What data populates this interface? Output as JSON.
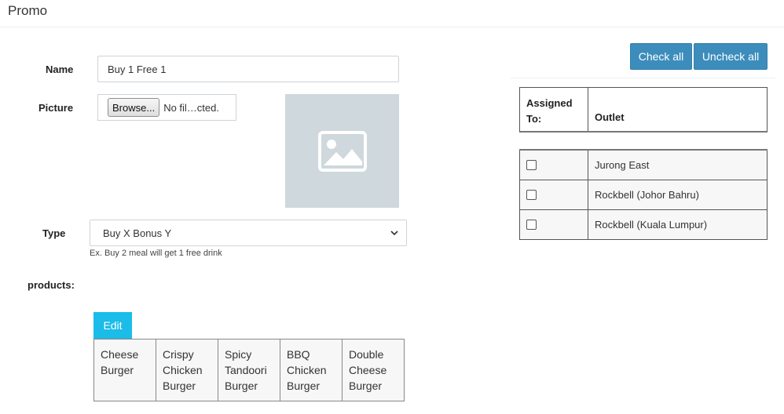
{
  "page": {
    "title": "Promo"
  },
  "form": {
    "name_label": "Name",
    "name_value": "Buy 1 Free 1",
    "picture_label": "Picture",
    "browse_label": "Browse...",
    "file_status": "No fil…cted.",
    "type_label": "Type",
    "type_value": "Buy X Bonus Y",
    "type_help": "Ex. Buy 2 meal will get 1 free drink",
    "products_label": "products:",
    "edit_label": "Edit",
    "products": [
      "Cheese Burger",
      "Crispy Chicken Burger",
      "Spicy Tandoori Burger",
      "BBQ Chicken Burger",
      "Double Cheese Burger"
    ]
  },
  "outlets": {
    "check_all_label": "Check all",
    "uncheck_all_label": "Uncheck all",
    "col_assigned": "Assigned To:",
    "col_outlet": "Outlet",
    "rows": [
      {
        "name": "Jurong East",
        "checked": false
      },
      {
        "name": "Rockbell (Johor Bahru)",
        "checked": false
      },
      {
        "name": "Rockbell (Kuala Lumpur)",
        "checked": false
      }
    ]
  },
  "colors": {
    "primary": "#3c8dbc",
    "info": "#1bbce8",
    "placeholder": "#cfd8dc"
  },
  "icons": {
    "picture_placeholder": "image-icon",
    "select_arrow": "chevron-down-icon"
  }
}
